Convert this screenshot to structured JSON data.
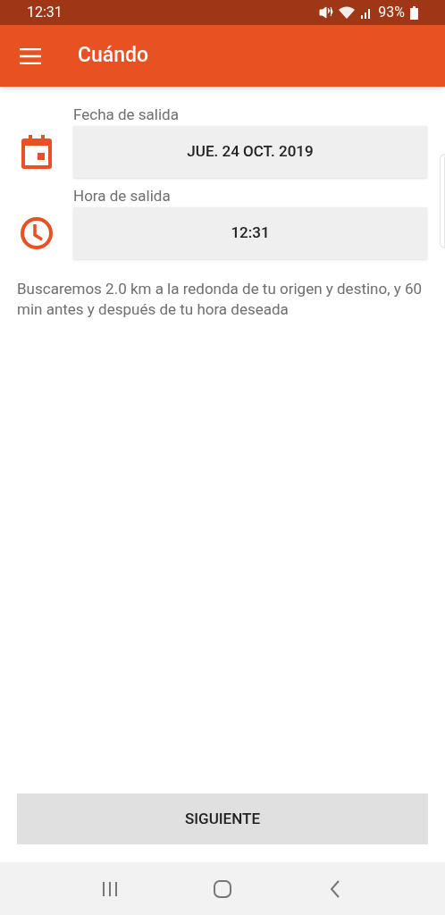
{
  "status_bar": {
    "time": "12:31",
    "battery": "93%"
  },
  "app_bar": {
    "title": "Cuándo"
  },
  "fields": [
    {
      "kind": "date",
      "label": "Fecha de salida",
      "value": "JUE. 24 OCT. 2019"
    },
    {
      "kind": "time",
      "label": "Hora de salida",
      "value": "12:31"
    }
  ],
  "info": "Buscaremos 2.0 km a la redonda de tu origen y destino, y 60 min antes y después de tu hora deseada",
  "next_button": "SIGUIENTE"
}
